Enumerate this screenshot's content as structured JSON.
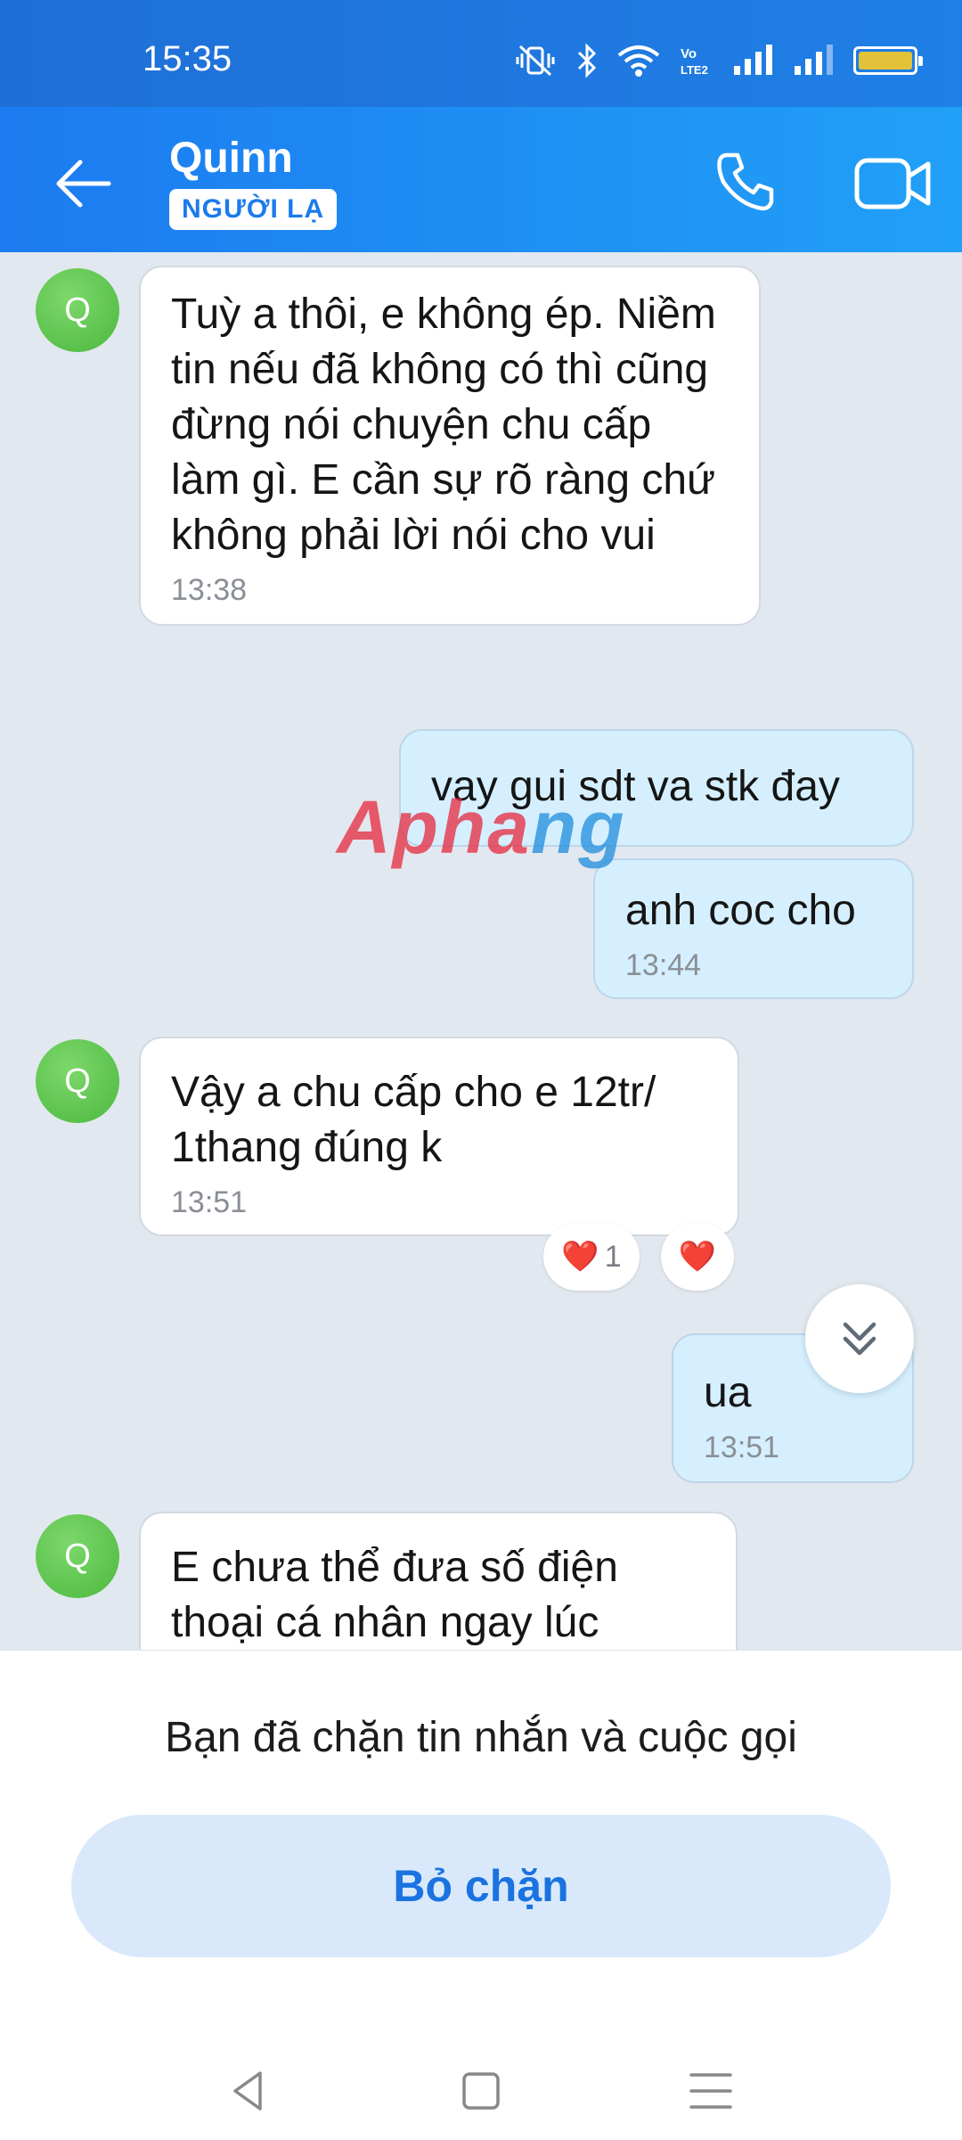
{
  "status_bar": {
    "time": "15:35",
    "icons": [
      "mute-vibrate-icon",
      "bluetooth-icon",
      "wifi-icon",
      "volte-icon",
      "signal-icon",
      "signal-icon-2",
      "battery-icon"
    ],
    "volte_label": "Vo LTE2",
    "battery_color": "#e3c23a"
  },
  "header": {
    "contact_name": "Quinn",
    "badge": "NGƯỜI LẠ",
    "back_icon": "arrow-left-icon",
    "call_icon": "phone-icon",
    "video_icon": "video-camera-icon"
  },
  "messages": [
    {
      "direction": "in",
      "avatar": "Q",
      "text": "Tuỳ a thôi, e không ép. Niềm tin nếu đã không có thì cũng đừng nói chuyện chu cấp làm gì. E cần sự rõ ràng chứ không phải lời nói cho vui",
      "time": "13:38"
    },
    {
      "direction": "out",
      "text": "vay gui sdt va stk đay",
      "time": ""
    },
    {
      "direction": "out",
      "text": "anh coc cho",
      "time": "13:44"
    },
    {
      "direction": "in",
      "avatar": "Q",
      "text": "Vậy a chu cấp cho e 12tr/ 1thang đúng k",
      "time": "13:51",
      "reactions": [
        {
          "emoji": "❤️",
          "count": "1"
        },
        {
          "emoji": "❤️",
          "count": ""
        }
      ]
    },
    {
      "direction": "out",
      "text": "ua",
      "time": "13:51"
    },
    {
      "direction": "in",
      "avatar": "Q",
      "text": "E chưa thể đưa số điện thoại cá nhân ngay lúc",
      "time": ""
    }
  ],
  "watermark": {
    "part1": "Apha",
    "part2": "ng"
  },
  "blocked_panel": {
    "message": "Bạn đã chặn tin nhắn và cuộc gọi",
    "unblock_label": "Bỏ chặn"
  },
  "colors": {
    "header_start": "#1c7bf0",
    "header_end": "#21a0f7",
    "chat_bg": "#e2e8ef",
    "outgoing_bubble": "#d5efff",
    "unblock_button": "#d9e9fb",
    "unblock_text": "#1a73e0"
  }
}
